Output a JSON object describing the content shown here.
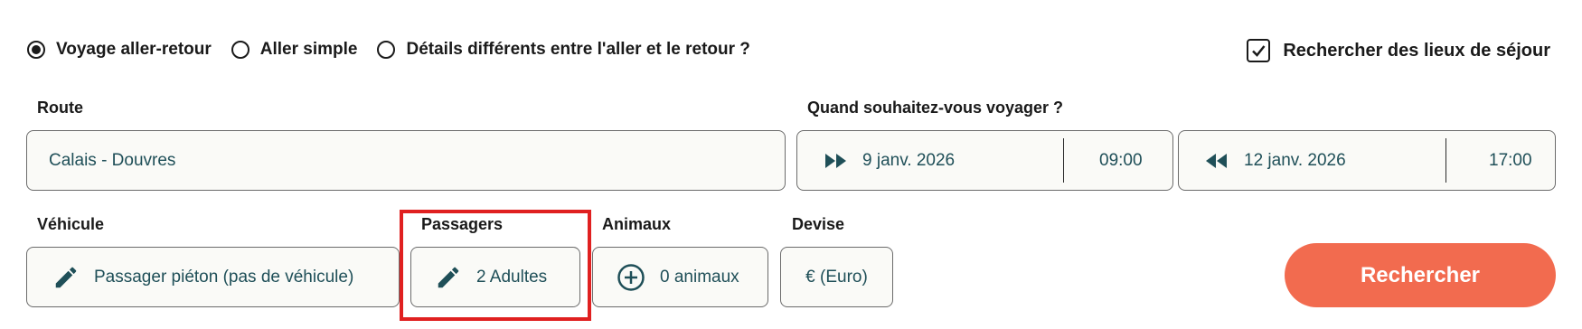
{
  "trip_type": {
    "options": [
      {
        "label": "Voyage aller-retour",
        "selected": true
      },
      {
        "label": "Aller simple",
        "selected": false
      },
      {
        "label": "Détails différents entre l'aller et le retour ?",
        "selected": false
      }
    ]
  },
  "stay_checkbox": {
    "label": "Rechercher des lieux de séjour",
    "checked": true
  },
  "route": {
    "label": "Route",
    "value": "Calais - Douvres"
  },
  "when": {
    "label": "Quand souhaitez-vous voyager ?",
    "outbound": {
      "date": "9 janv. 2026",
      "time": "09:00"
    },
    "return": {
      "date": "12 janv. 2026",
      "time": "17:00"
    }
  },
  "vehicle": {
    "label": "Véhicule",
    "value": "Passager piéton (pas de véhicule)"
  },
  "passengers": {
    "label": "Passagers",
    "value": "2 Adultes"
  },
  "pets": {
    "label": "Animaux",
    "value": "0 animaux"
  },
  "currency": {
    "label": "Devise",
    "value": "€ (Euro)"
  },
  "search_button": {
    "label": "Rechercher"
  },
  "colors": {
    "accent": "#f26b4f",
    "field_text": "#1f4f58",
    "highlight": "#e02020"
  }
}
